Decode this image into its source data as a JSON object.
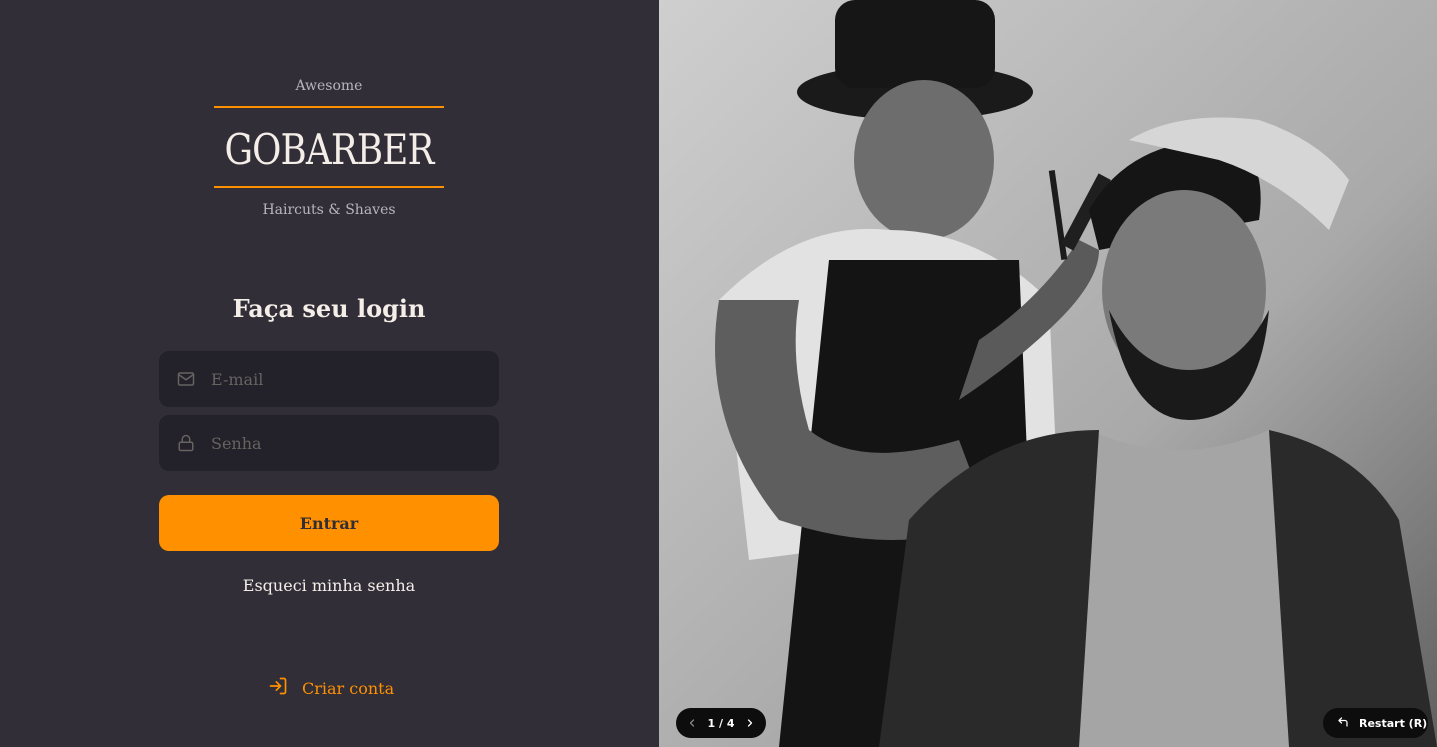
{
  "logo": {
    "top_text": "Awesome",
    "brand": "GOBARBER",
    "bottom_text": "Haircuts & Shaves",
    "accent_color": "#ff9000"
  },
  "login": {
    "title": "Faça seu login",
    "email_placeholder": "E-mail",
    "email_value": "",
    "email_icon": "mail-icon",
    "password_placeholder": "Senha",
    "password_value": "",
    "password_icon": "lock-icon",
    "submit_label": "Entrar",
    "forgot_label": "Esqueci minha senha"
  },
  "signup": {
    "label": "Criar conta",
    "icon": "log-in-icon"
  },
  "slideshow": {
    "counter": "1 / 4",
    "prev_icon": "chevron-left-icon",
    "next_icon": "chevron-right-icon",
    "restart_label": "Restart (R)",
    "restart_icon": "undo-icon"
  },
  "colors": {
    "background": "#312e38",
    "input_background": "#232129",
    "text": "#f4ede8",
    "placeholder": "#666360",
    "primary": "#ff9000"
  }
}
